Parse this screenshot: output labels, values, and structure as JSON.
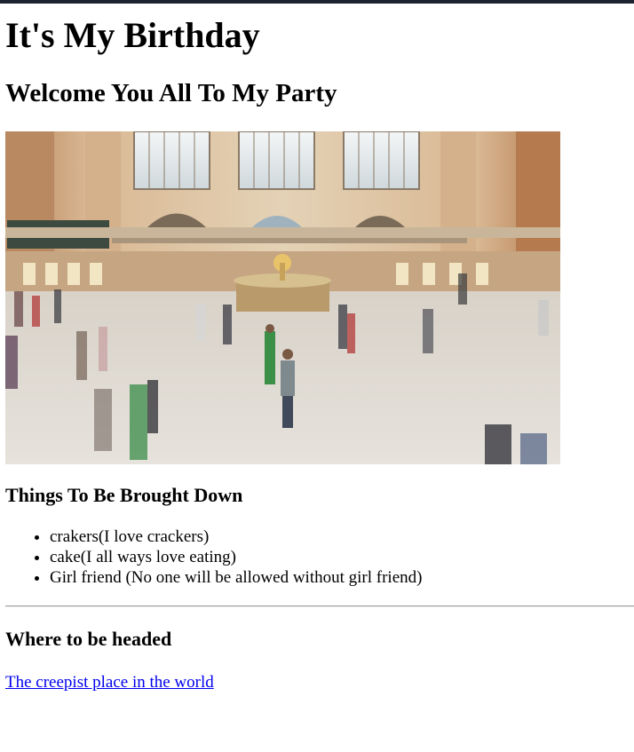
{
  "page": {
    "title": "It's My Birthday",
    "subtitle": "Welcome You All To My Party"
  },
  "things_section": {
    "heading": "Things To Be Brought Down",
    "items": [
      "crakers(I love crackers)",
      "cake(I all ways love eating)",
      "Girl friend (No one will be allowed without girl friend)"
    ]
  },
  "where_section": {
    "heading": "Where to be headed",
    "link_text": "The creepist place in the world"
  }
}
